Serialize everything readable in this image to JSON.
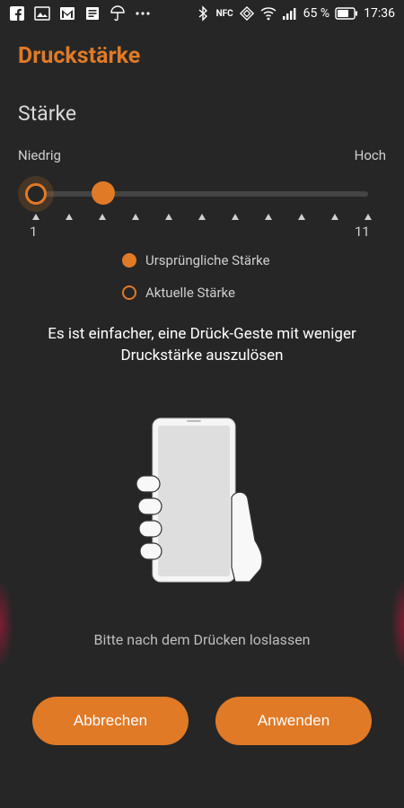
{
  "status_bar": {
    "left_icons": [
      "facebook-icon",
      "gallery-icon",
      "gmail-icon",
      "notes-icon",
      "weather-icon",
      "more-icon"
    ],
    "nfc": "NFC",
    "battery": "65 %",
    "time": "17:36"
  },
  "title": "Druckstärke",
  "section_title": "Stärke",
  "slider": {
    "label_low": "Niedrig",
    "label_high": "Hoch",
    "min": "1",
    "max": "11",
    "current_level": 1,
    "original_level": 3
  },
  "legend": {
    "original": "Ursprüngliche Stärke",
    "current": "Aktuelle Stärke"
  },
  "message": "Es ist einfacher, eine Drück-Geste mit weniger Druckstärke auszulösen",
  "hint": "Bitte nach dem Drücken loslassen",
  "buttons": {
    "cancel": "Abbrechen",
    "apply": "Anwenden"
  },
  "colors": {
    "accent": "#e07a27",
    "background": "#262626"
  }
}
